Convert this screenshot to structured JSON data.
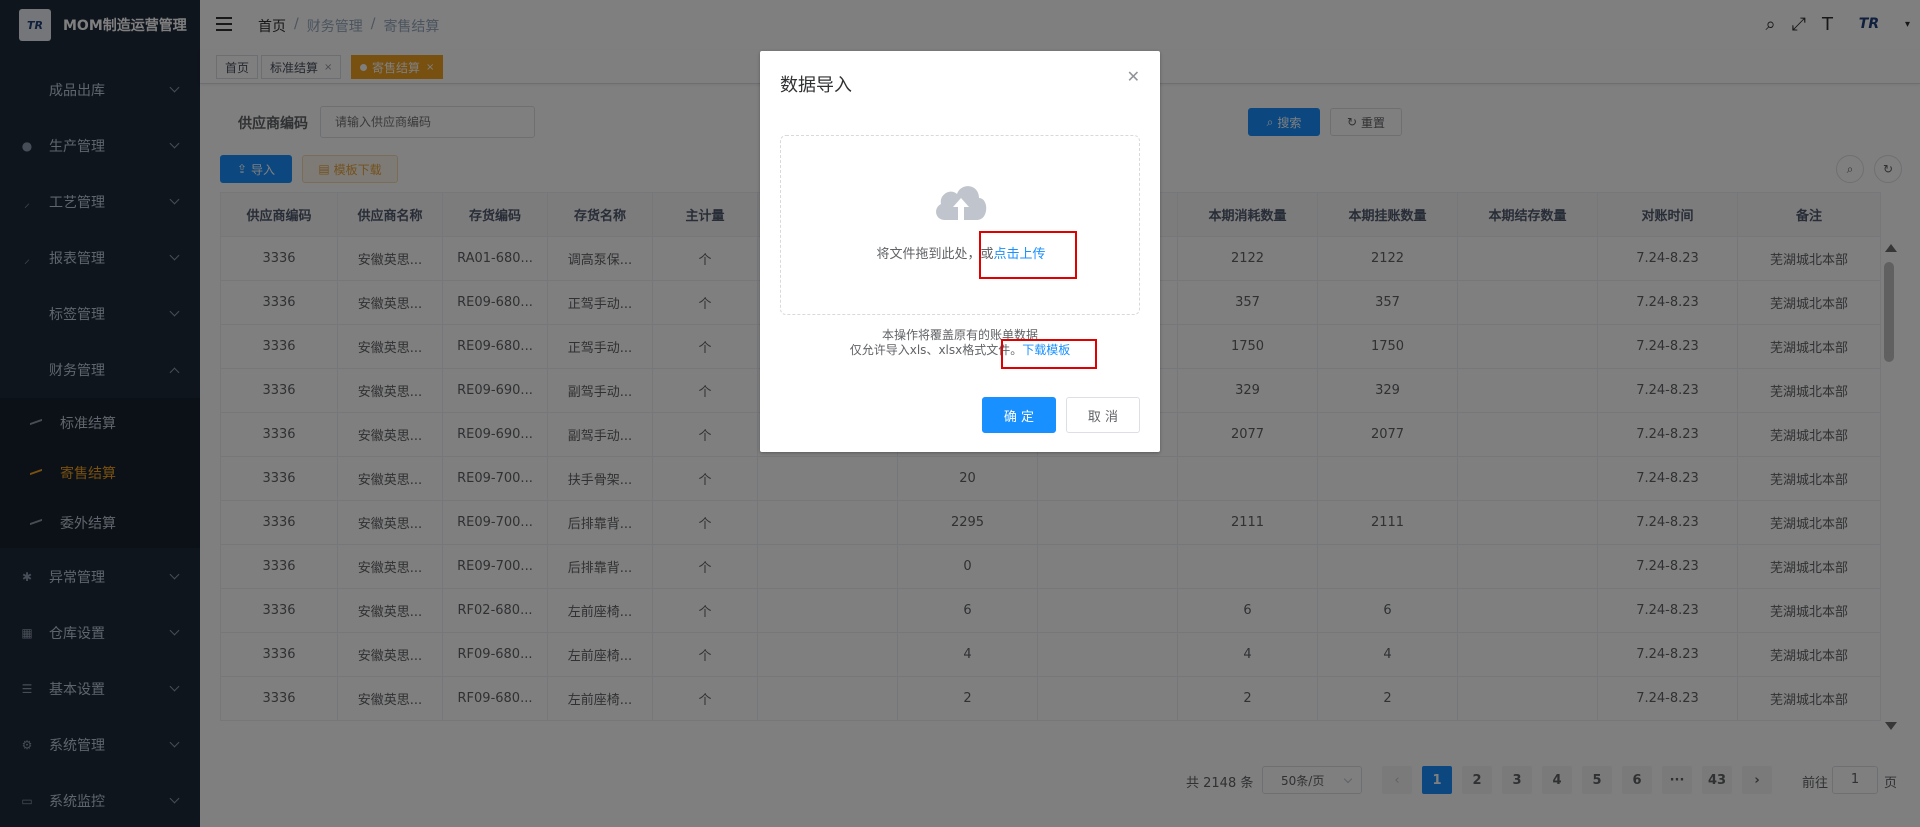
{
  "app": {
    "title": "MOM制造运营管理",
    "logo_text": "TR"
  },
  "sidebar": {
    "items": [
      {
        "label": "成品出库",
        "icon": "none",
        "arrow": "down"
      },
      {
        "label": "生产管理",
        "icon": "person-icon",
        "arrow": "down"
      },
      {
        "label": "工艺管理",
        "icon": "tool-icon",
        "arrow": "down"
      },
      {
        "label": "报表管理",
        "icon": "tool-icon",
        "arrow": "down"
      },
      {
        "label": "标签管理",
        "icon": "none",
        "arrow": "down"
      },
      {
        "label": "财务管理",
        "icon": "none",
        "arrow": "up"
      },
      {
        "label": "异常管理",
        "icon": "bug-icon",
        "arrow": "down"
      },
      {
        "label": "仓库设置",
        "icon": "grid-icon",
        "arrow": "down"
      },
      {
        "label": "基本设置",
        "icon": "sliders-icon",
        "arrow": "down"
      },
      {
        "label": "系统管理",
        "icon": "gear-icon",
        "arrow": "down"
      },
      {
        "label": "系统监控",
        "icon": "monitor-icon",
        "arrow": "down"
      }
    ],
    "sub_items": [
      {
        "label": "标准结算",
        "active": false
      },
      {
        "label": "寄售结算",
        "active": true
      },
      {
        "label": "委外结算",
        "active": false
      }
    ]
  },
  "navbar": {
    "breadcrumb": [
      "首页",
      "财务管理",
      "寄售结算"
    ],
    "separator": "/",
    "icons": [
      "search-icon",
      "fullscreen-icon",
      "font-size-icon",
      "avatar"
    ]
  },
  "tags": [
    {
      "label": "首页",
      "closable": false,
      "active": false
    },
    {
      "label": "标准结算",
      "closable": true,
      "active": false
    },
    {
      "label": "寄售结算",
      "closable": true,
      "active": true
    }
  ],
  "filter": {
    "label": "供应商编码",
    "placeholder": "请输入供应商编码",
    "search_btn": "搜索",
    "reset_btn": "重置"
  },
  "toolbar": {
    "import_btn": "导入",
    "template_btn": "模板下载"
  },
  "table": {
    "columns": [
      "供应商编码",
      "供应商名称",
      "存货编码",
      "存货名称",
      "主计量",
      "",
      "",
      "",
      "本期消耗数量",
      "本期挂账数量",
      "本期结存数量",
      "对账时间",
      "备注"
    ],
    "rows": [
      [
        "3336",
        "安徽英思...",
        "RA01-680...",
        "调高泵保...",
        "个",
        "",
        "",
        "",
        "2122",
        "2122",
        "",
        "7.24-8.23",
        "芜湖城北本部"
      ],
      [
        "3336",
        "安徽英思...",
        "RE09-680...",
        "正驾手动...",
        "个",
        "",
        "",
        "",
        "357",
        "357",
        "",
        "7.24-8.23",
        "芜湖城北本部"
      ],
      [
        "3336",
        "安徽英思...",
        "RE09-680...",
        "正驾手动...",
        "个",
        "",
        "",
        "",
        "1750",
        "1750",
        "",
        "7.24-8.23",
        "芜湖城北本部"
      ],
      [
        "3336",
        "安徽英思...",
        "RE09-690...",
        "副驾手动...",
        "个",
        "",
        "",
        "",
        "329",
        "329",
        "",
        "7.24-8.23",
        "芜湖城北本部"
      ],
      [
        "3336",
        "安徽英思...",
        "RE09-690...",
        "副驾手动...",
        "个",
        "",
        "",
        "",
        "2077",
        "2077",
        "",
        "7.24-8.23",
        "芜湖城北本部"
      ],
      [
        "3336",
        "安徽英思...",
        "RE09-700...",
        "扶手骨架...",
        "个",
        "",
        "20",
        "",
        "",
        "",
        "",
        "7.24-8.23",
        "芜湖城北本部"
      ],
      [
        "3336",
        "安徽英思...",
        "RE09-700...",
        "后排靠背...",
        "个",
        "",
        "2295",
        "",
        "2111",
        "2111",
        "",
        "7.24-8.23",
        "芜湖城北本部"
      ],
      [
        "3336",
        "安徽英思...",
        "RE09-700...",
        "后排靠背...",
        "个",
        "",
        "0",
        "",
        "",
        "",
        "",
        "7.24-8.23",
        "芜湖城北本部"
      ],
      [
        "3336",
        "安徽英思...",
        "RF02-680...",
        "左前座椅...",
        "个",
        "",
        "6",
        "",
        "6",
        "6",
        "",
        "7.24-8.23",
        "芜湖城北本部"
      ],
      [
        "3336",
        "安徽英思...",
        "RF09-680...",
        "左前座椅...",
        "个",
        "",
        "4",
        "",
        "4",
        "4",
        "",
        "7.24-8.23",
        "芜湖城北本部"
      ],
      [
        "3336",
        "安徽英思...",
        "RF09-680...",
        "左前座椅...",
        "个",
        "",
        "2",
        "",
        "2",
        "2",
        "",
        "7.24-8.23",
        "芜湖城北本部"
      ]
    ]
  },
  "pagination": {
    "total": "共 2148 条",
    "page_size": "50条/页",
    "pages": [
      "1",
      "2",
      "3",
      "4",
      "5",
      "6",
      "···",
      "43"
    ],
    "current": "1",
    "goto_prefix": "前往",
    "goto_value": "1",
    "goto_suffix": "页"
  },
  "dialog": {
    "title": "数据导入",
    "upload_text": "将文件拖到此处，或",
    "upload_link": "点击上传",
    "tip_line1": "本操作将覆盖原有的账单数据",
    "tip_line2": "仅允许导入xls、xlsx格式文件。",
    "tip_link": "下载模板",
    "confirm_btn": "确 定",
    "cancel_btn": "取 消"
  }
}
